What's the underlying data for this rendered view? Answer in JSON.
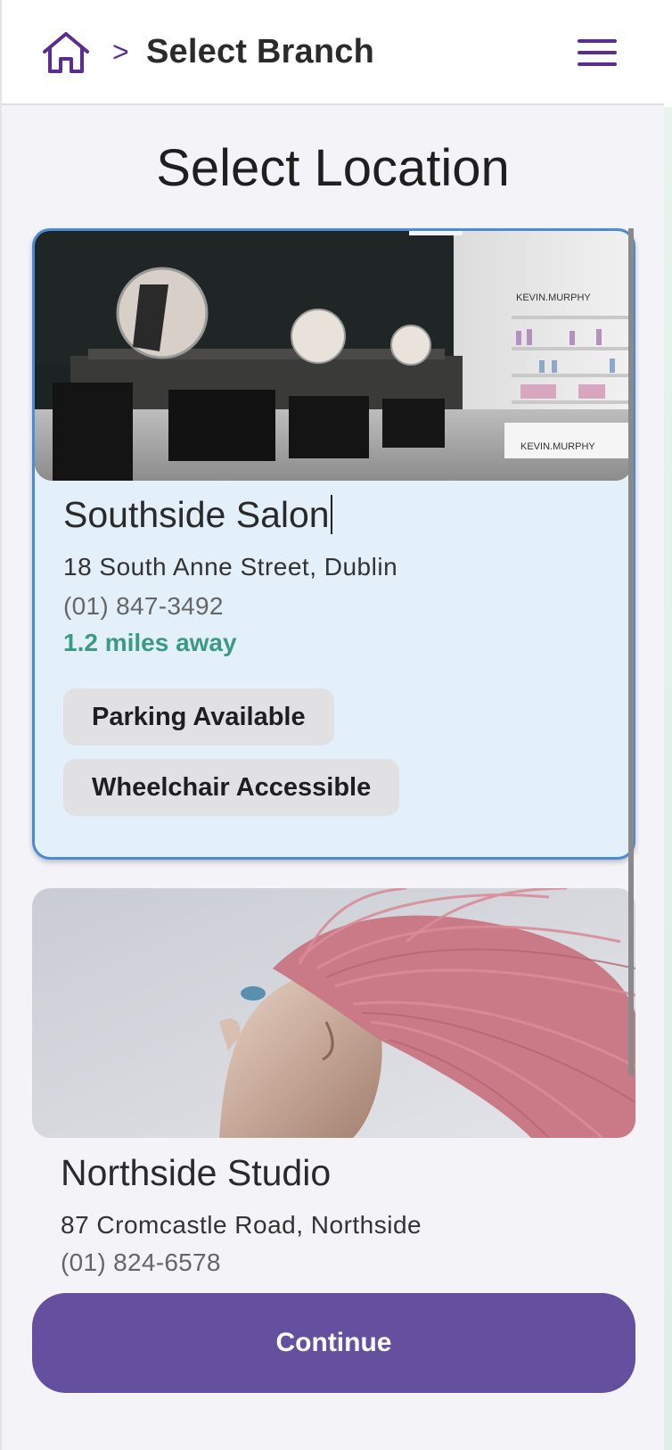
{
  "header": {
    "breadcrumb_separator": ">",
    "breadcrumb_current": "Select Branch",
    "home_icon": "home-icon",
    "menu_icon": "hamburger-menu-icon"
  },
  "page": {
    "title": "Select Location"
  },
  "locations": [
    {
      "name": "Southside Salon",
      "address": "18 South Anne Street, Dublin",
      "phone": "(01) 847-3492",
      "distance": "1.2 miles away",
      "tags": [
        "Parking Available",
        "Wheelchair Accessible"
      ],
      "selected": true
    },
    {
      "name": "Northside Studio",
      "address": "87 Cromcastle Road, Northside",
      "phone": "(01) 824-6578",
      "selected": false
    }
  ],
  "actions": {
    "continue_label": "Continue"
  },
  "colors": {
    "brand_purple": "#5b2d90",
    "button_purple": "#6550a0",
    "selected_border": "#4a8ad6",
    "selected_bg": "#e3eff9",
    "distance_green": "#3c9a82"
  }
}
